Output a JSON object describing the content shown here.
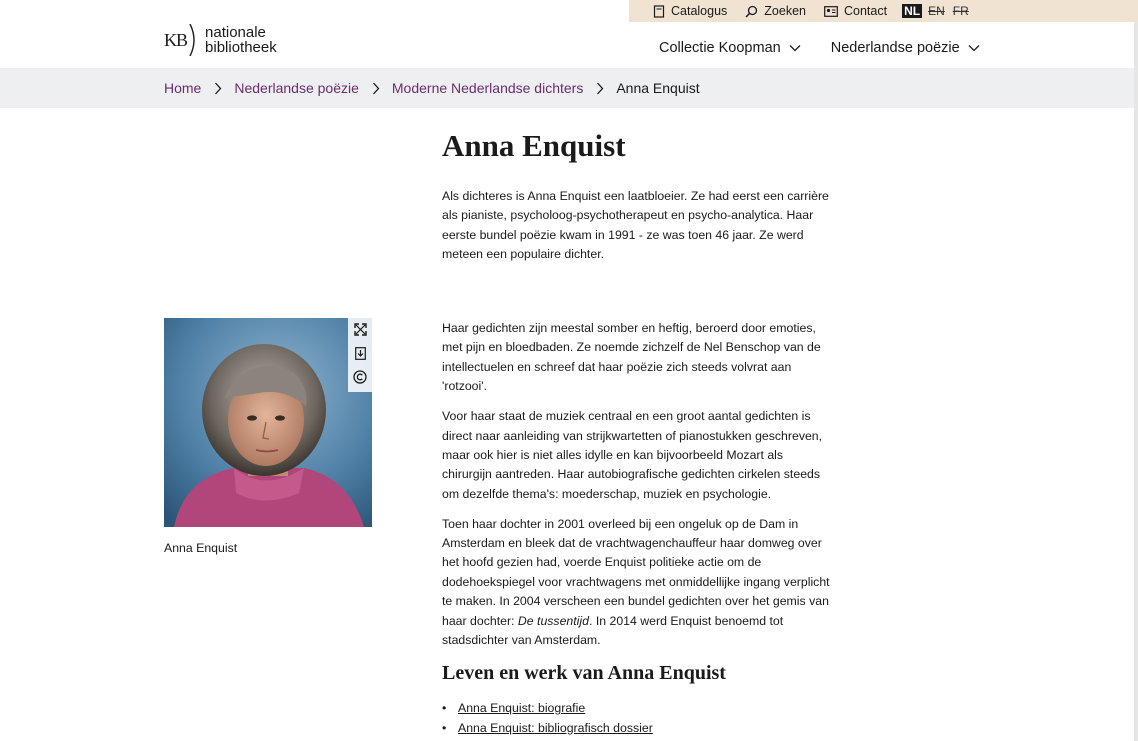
{
  "utility": {
    "catalogus": "Catalogus",
    "zoeken": "Zoeken",
    "contact": "Contact",
    "languages": {
      "nl": "NL",
      "en": "EN",
      "fr": "FR"
    }
  },
  "logo": {
    "mark": "KB",
    "line1": "nationale",
    "line2": "bibliotheek"
  },
  "nav": {
    "item1": "Collectie Koopman",
    "item2": "Nederlandse poëzie"
  },
  "breadcrumb": {
    "home": "Home",
    "level1": "Nederlandse poëzie",
    "level2": "Moderne Nederlandse dichters",
    "current": "Anna Enquist"
  },
  "page": {
    "title": "Anna Enquist",
    "intro": "Als dichteres is Anna Enquist een laatbloeier. Ze had eerst een carrière als pianiste, psycholoog-psychotherapeut en psycho-analytica. Haar eerste bundel poëzie kwam in 1991 - ze was toen 46 jaar. Ze werd meteen een populaire dichter.",
    "para1": "Haar gedichten zijn meestal somber en heftig, beroerd door emoties, met pijn en bloedbaden. Ze noemde zichzelf de Nel Benschop van de intellectuelen en schreef dat haar poëzie zich steeds volvrat aan 'rotzooi'.",
    "para2": "Voor haar staat de muziek centraal en een groot aantal gedichten is direct naar aanleiding van strijkwartetten of pianostukken geschreven, maar ook hier is niet alles idylle en kan bijvoorbeeld Mozart als chirurgijn aantreden. Haar autobiografische gedichten cirkelen steeds om dezelfde thema's: moederschap, muziek en psychologie.",
    "para3_before": "Toen haar dochter in 2001 overleed bij een ongeluk op de Dam in Amsterdam en bleek dat de vrachtwagenchauffeur haar domweg over het hoofd gezien had, voerde Enquist politieke actie om de dodehoekspiegel voor vrachtwagens met onmiddellijke ingang verplicht te maken. In 2004 verscheen een bundel gedichten over het gemis van haar dochter: ",
    "para3_italic": "De tussentijd",
    "para3_after": ". In 2014 werd Enquist benoemd tot stadsdichter van Amsterdam.",
    "section_heading": "Leven en werk van Anna Enquist",
    "links": [
      "Anna Enquist: biografie",
      "Anna Enquist: bibliografisch dossier"
    ],
    "caption": "Anna Enquist"
  },
  "colors": {
    "utility_bg": "#f0e3d1",
    "breadcrumb_bg": "#eeeff1",
    "link_purple": "#6b2c6e"
  },
  "icons": [
    "book-icon",
    "search-icon",
    "contact-card-icon",
    "chevron-down-icon",
    "chevron-right-icon",
    "expand-icon",
    "download-icon",
    "copyright-icon"
  ]
}
